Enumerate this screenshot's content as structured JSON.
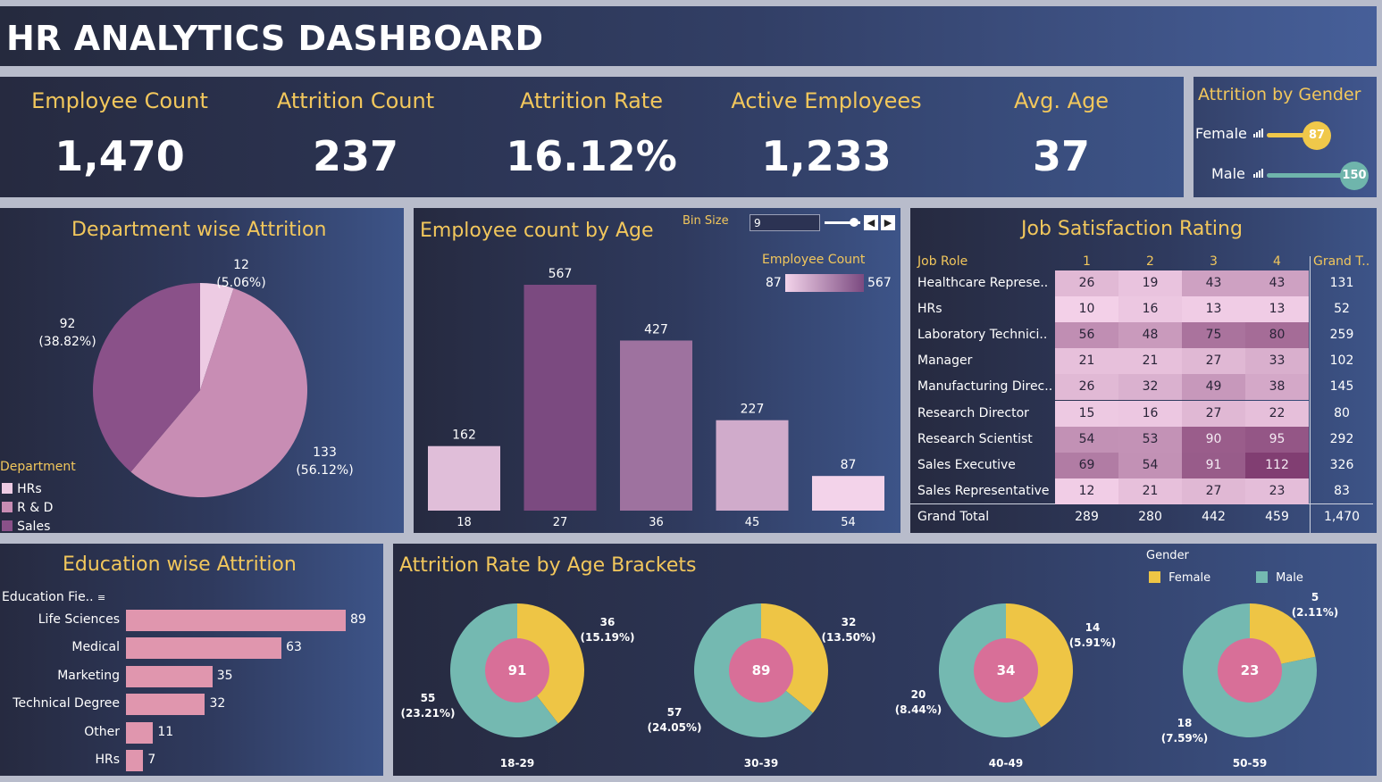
{
  "title": "HR ANALYTICS DASHBOARD",
  "kpis": [
    {
      "label": "Employee Count",
      "value": "1,470"
    },
    {
      "label": "Attrition Count",
      "value": "237"
    },
    {
      "label": "Attrition Rate",
      "value": "16.12%"
    },
    {
      "label": "Active Employees",
      "value": "1,233"
    },
    {
      "label": "Avg. Age",
      "value": "37"
    }
  ],
  "gender": {
    "title": "Attrition by Gender",
    "female_label": "Female",
    "female_value": "87",
    "male_label": "Male",
    "male_value": "150",
    "female_color": "#f0c84a",
    "male_color": "#6fb5ac"
  },
  "colors": {
    "accent": "#f2c75c",
    "hrs": "#edcbe3",
    "rnd": "#c88db4",
    "sales": "#8a5189",
    "female": "#eec545",
    "male": "#74b9b1",
    "center": "#d86f98",
    "edu_bar": "#e096ae"
  },
  "chart_data": [
    {
      "type": "pie",
      "title": "Department wise Attrition",
      "legend_title": "Department",
      "legend_placement": "bottom-left",
      "categories": [
        "HRs",
        "R & D",
        "Sales"
      ],
      "values": [
        12,
        133,
        92
      ],
      "labels": [
        {
          "value": "12",
          "pct": "(5.06%)"
        },
        {
          "value": "133",
          "pct": "(56.12%)"
        },
        {
          "value": "92",
          "pct": "(38.82%)"
        }
      ]
    },
    {
      "type": "bar",
      "title": "Employee count by Age",
      "bin_size_label": "Bin Size",
      "bin_size_value": "9",
      "legend_title": "Employee Count",
      "legend_min": "87",
      "legend_max": "567",
      "categories": [
        "18",
        "27",
        "36",
        "45",
        "54"
      ],
      "values": [
        162,
        567,
        427,
        227,
        87
      ]
    },
    {
      "type": "table",
      "title": "Job Satisfaction Rating",
      "header_role": "Job Role",
      "columns": [
        "1",
        "2",
        "3",
        "4"
      ],
      "header_total": "Grand T..",
      "rows": [
        {
          "role": "Healthcare Represe..",
          "values": [
            "26",
            "19",
            "43",
            "43"
          ],
          "total": "131"
        },
        {
          "role": "HRs",
          "values": [
            "10",
            "16",
            "13",
            "13"
          ],
          "total": "52"
        },
        {
          "role": "Laboratory Technici..",
          "values": [
            "56",
            "48",
            "75",
            "80"
          ],
          "total": "259"
        },
        {
          "role": "Manager",
          "values": [
            "21",
            "21",
            "27",
            "33"
          ],
          "total": "102"
        },
        {
          "role": "Manufacturing Direc..",
          "values": [
            "26",
            "32",
            "49",
            "38"
          ],
          "total": "145"
        },
        {
          "role": "Research Director",
          "values": [
            "15",
            "16",
            "27",
            "22"
          ],
          "total": "80"
        },
        {
          "role": "Research Scientist",
          "values": [
            "54",
            "53",
            "90",
            "95"
          ],
          "total": "292"
        },
        {
          "role": "Sales Executive",
          "values": [
            "69",
            "54",
            "91",
            "112"
          ],
          "total": "326"
        },
        {
          "role": "Sales Representative",
          "values": [
            "12",
            "21",
            "27",
            "23"
          ],
          "total": "83"
        }
      ],
      "grand_total": {
        "role": "Grand Total",
        "values": [
          "289",
          "280",
          "442",
          "459"
        ],
        "total": "1,470"
      }
    },
    {
      "type": "bar",
      "title": "Education wise Attrition",
      "axis_label": "Education Fie..",
      "orientation": "horizontal",
      "categories": [
        "Life Sciences",
        "Medical",
        "Marketing",
        "Technical Degree",
        "Other",
        "HRs"
      ],
      "values": [
        89,
        63,
        35,
        32,
        11,
        7
      ]
    },
    {
      "type": "pie",
      "title": "Attrition Rate by Age Brackets",
      "legend_title": "Gender",
      "legend_items": [
        "Female",
        "Male"
      ],
      "legend_placement": "top-right",
      "brackets": [
        {
          "label": "18-29",
          "total": "91",
          "female": 36,
          "female_label": "36",
          "female_pct": "(15.19%)",
          "male": 55,
          "male_label": "55",
          "male_pct": "(23.21%)"
        },
        {
          "label": "30-39",
          "total": "89",
          "female": 32,
          "female_label": "32",
          "female_pct": "(13.50%)",
          "male": 57,
          "male_label": "57",
          "male_pct": "(24.05%)"
        },
        {
          "label": "40-49",
          "total": "34",
          "female": 14,
          "female_label": "14",
          "female_pct": "(5.91%)",
          "male": 20,
          "male_label": "20",
          "male_pct": "(8.44%)"
        },
        {
          "label": "50-59",
          "total": "23",
          "female": 5,
          "female_label": "5",
          "female_pct": "(2.11%)",
          "male": 18,
          "male_label": "18",
          "male_pct": "(7.59%)"
        }
      ]
    }
  ]
}
